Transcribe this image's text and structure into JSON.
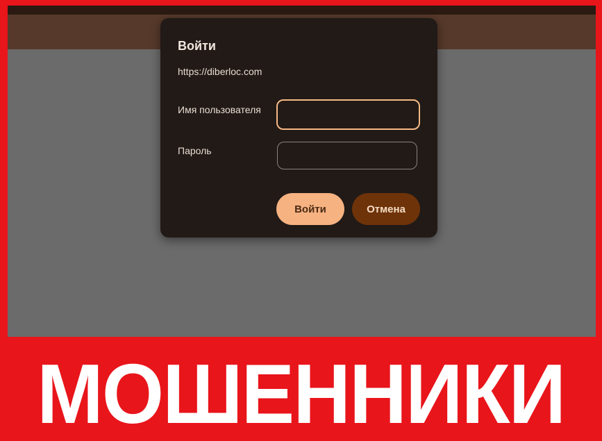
{
  "dialog": {
    "title": "Войти",
    "url": "https://diberloc.com",
    "username_label": "Имя пользователя",
    "username_value": "",
    "password_label": "Пароль",
    "password_value": "",
    "login_button": "Войти",
    "cancel_button": "Отмена"
  },
  "banner": {
    "text": "МОШЕННИКИ"
  },
  "colors": {
    "warning_red": "#e8151b",
    "dialog_bg": "#211a17",
    "accent_peach": "#f6b281",
    "cancel_brown": "#6f3309"
  }
}
